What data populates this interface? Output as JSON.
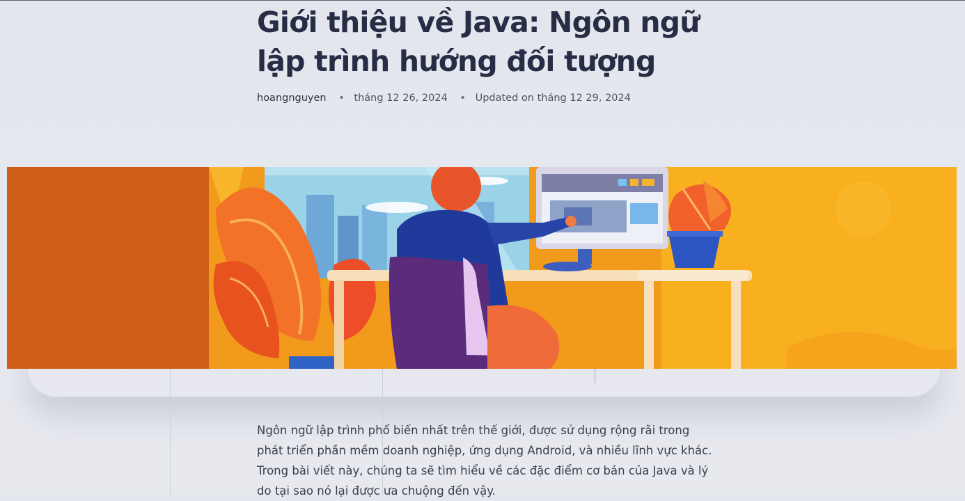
{
  "article": {
    "title": "Giới thiệu về Java: Ngôn ngữ lập trình hướng đối tượng",
    "author": "hoangnguyen",
    "separator": "•",
    "published": "tháng 12 26, 2024",
    "updated": "Updated on tháng 12 29, 2024",
    "intro": "Ngôn ngữ lập trình phổ biến nhất trên thế giới, được sử dụng rộng rãi trong phát triển phần mềm doanh nghiệp, ứng dụng Android, và nhiều lĩnh vực khác. Trong bài viết này, chúng ta sẽ tìm hiểu về các đặc điểm cơ bản của Java và lý do tại sao nó lại được ưa chuộng đến vậy."
  },
  "hero": {
    "icon": "developer-at-desk-illustration",
    "colors": {
      "orange": "#d9651a",
      "yellow": "#f7ad1d",
      "navy": "#2a3b8f",
      "purple": "#5a2a7a"
    }
  },
  "theme": {
    "text": "#262d45",
    "background": "#e5e7ee"
  }
}
